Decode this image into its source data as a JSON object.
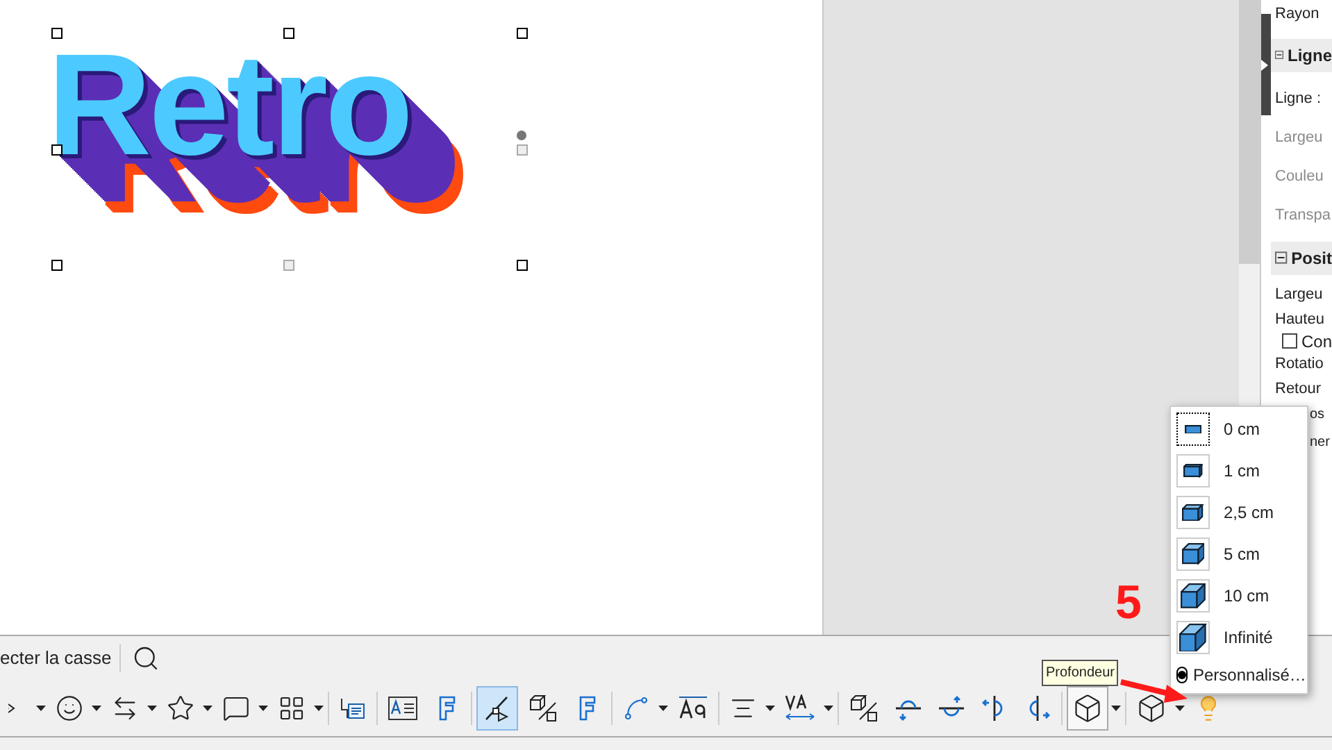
{
  "canvas": {
    "fontwork_text": "Retro"
  },
  "sidebar": {
    "rows": [
      {
        "kind": "label",
        "text": "Rayon",
        "disabled": false
      },
      {
        "kind": "section",
        "text": "Ligne",
        "expanded": true
      },
      {
        "kind": "label",
        "text": "Ligne :",
        "disabled": false
      },
      {
        "kind": "label",
        "text": "Largeu",
        "disabled": true
      },
      {
        "kind": "label",
        "text": "Couleu",
        "disabled": true
      },
      {
        "kind": "label",
        "text": "Transpa",
        "disabled": true
      },
      {
        "kind": "section",
        "text": "Posit",
        "expanded": true
      },
      {
        "kind": "label",
        "text": "Largeu",
        "disabled": false
      },
      {
        "kind": "label",
        "text": "Hauteu",
        "disabled": false
      },
      {
        "kind": "checkbox",
        "text": "Con",
        "checked": false
      },
      {
        "kind": "label",
        "text": "Rotatio",
        "disabled": false
      },
      {
        "kind": "label",
        "text": "Retour",
        "disabled": false
      },
      {
        "kind": "fragment",
        "text": "os"
      },
      {
        "kind": "fragment",
        "text": "ner"
      }
    ]
  },
  "toolbar_1": {
    "text": "ecter la casse"
  },
  "toolbar_2": {
    "buttons": [
      {
        "dropdown": true,
        "selected": false
      },
      {
        "dropdown": true,
        "selected": false
      },
      {
        "dropdown": true,
        "selected": false
      },
      {
        "dropdown": true,
        "selected": false
      },
      {
        "dropdown": true,
        "selected": false
      },
      {
        "dropdown": true,
        "selected": false
      },
      {
        "dropdown": false,
        "selected": false
      },
      {
        "dropdown": false,
        "selected": false
      },
      {
        "dropdown": false,
        "selected": false
      },
      {
        "dropdown": false,
        "selected": true
      },
      {
        "dropdown": false,
        "selected": false
      },
      {
        "dropdown": false,
        "selected": false
      },
      {
        "dropdown": true,
        "selected": false
      },
      {
        "dropdown": false,
        "selected": false
      },
      {
        "dropdown": true,
        "selected": false
      },
      {
        "dropdown": true,
        "selected": false
      },
      {
        "dropdown": false,
        "selected": false
      },
      {
        "dropdown": false,
        "selected": false
      },
      {
        "dropdown": false,
        "selected": false
      },
      {
        "dropdown": false,
        "selected": false
      },
      {
        "dropdown": false,
        "selected": false
      },
      {
        "dropdown": true,
        "selected": true
      },
      {
        "dropdown": true,
        "selected": false
      },
      {
        "dropdown": false,
        "selected": false
      }
    ]
  },
  "depth_menu": {
    "items": [
      {
        "label": "0 cm",
        "selected": true
      },
      {
        "label": "1 cm",
        "selected": false
      },
      {
        "label": "2,5 cm",
        "selected": false
      },
      {
        "label": "5 cm",
        "selected": false
      },
      {
        "label": "10 cm",
        "selected": false
      },
      {
        "label": "Infinité",
        "selected": false
      }
    ],
    "custom": {
      "label": "Personnalisé…",
      "checked": true
    }
  },
  "tooltip": "Profondeur",
  "annotation": {
    "number": "5"
  }
}
